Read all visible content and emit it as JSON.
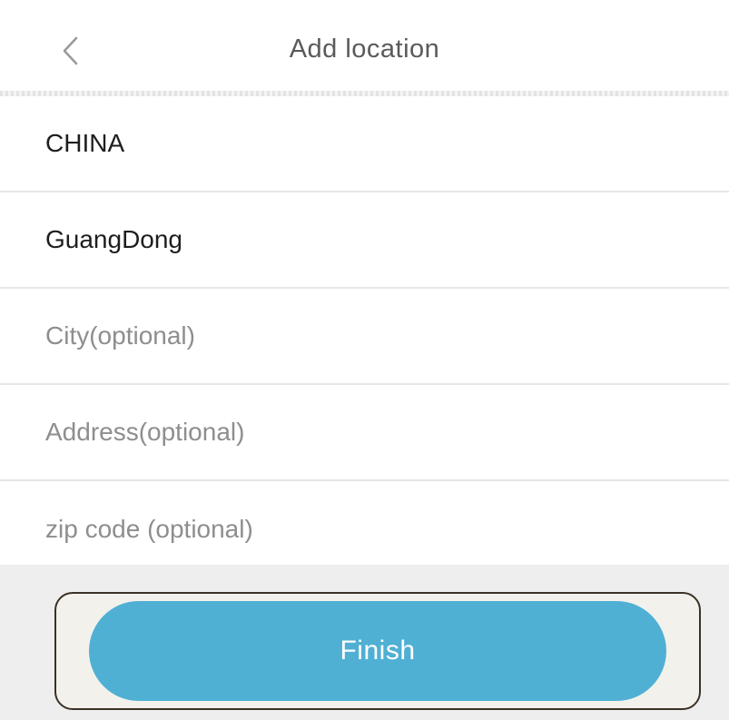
{
  "header": {
    "back_icon": "chevron-left-icon",
    "title": "Add location"
  },
  "form": {
    "country": "CHINA",
    "province": "GuangDong",
    "city_placeholder": "City(optional)",
    "address_placeholder": "Address(optional)",
    "zip_placeholder": "zip code (optional)"
  },
  "footer": {
    "finish_label": "Finish"
  },
  "colors": {
    "accent": "#4fb0d4",
    "title_text": "#5a5a5a",
    "placeholder_text": "#8e8e8e"
  }
}
